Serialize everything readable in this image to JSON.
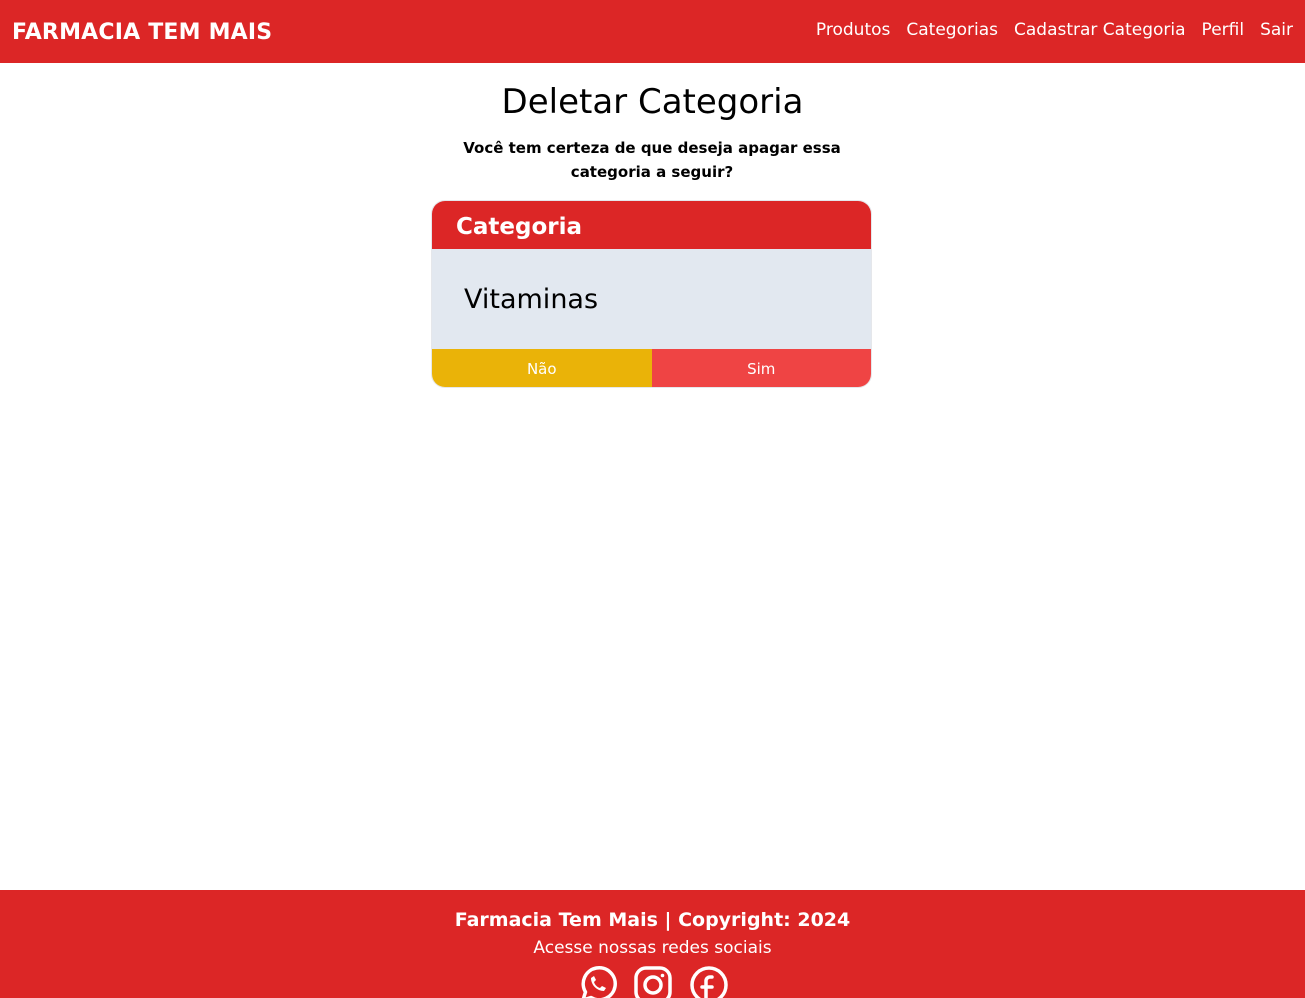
{
  "navbar": {
    "brand": "FARMACIA TEM MAIS",
    "links": [
      {
        "label": "Produtos"
      },
      {
        "label": "Categorias"
      },
      {
        "label": "Cadastrar Categoria"
      },
      {
        "label": "Perfil"
      },
      {
        "label": "Sair"
      }
    ]
  },
  "main": {
    "title": "Deletar Categoria",
    "confirm_text": "Você tem certeza de que deseja apagar essa categoria a seguir?",
    "card": {
      "header": "Categoria",
      "name": "Vitaminas",
      "no_label": "Não",
      "yes_label": "Sim"
    }
  },
  "footer": {
    "title": "Farmacia Tem Mais | Copyright: 2024",
    "subtitle": "Acesse nossas redes sociais",
    "social_icons": [
      "whatsapp-icon",
      "instagram-icon",
      "facebook-icon"
    ]
  },
  "colors": {
    "primary": "#dc2626",
    "card_body": "#e2e8f0",
    "no_button": "#eab308",
    "yes_button": "#ef4444"
  }
}
